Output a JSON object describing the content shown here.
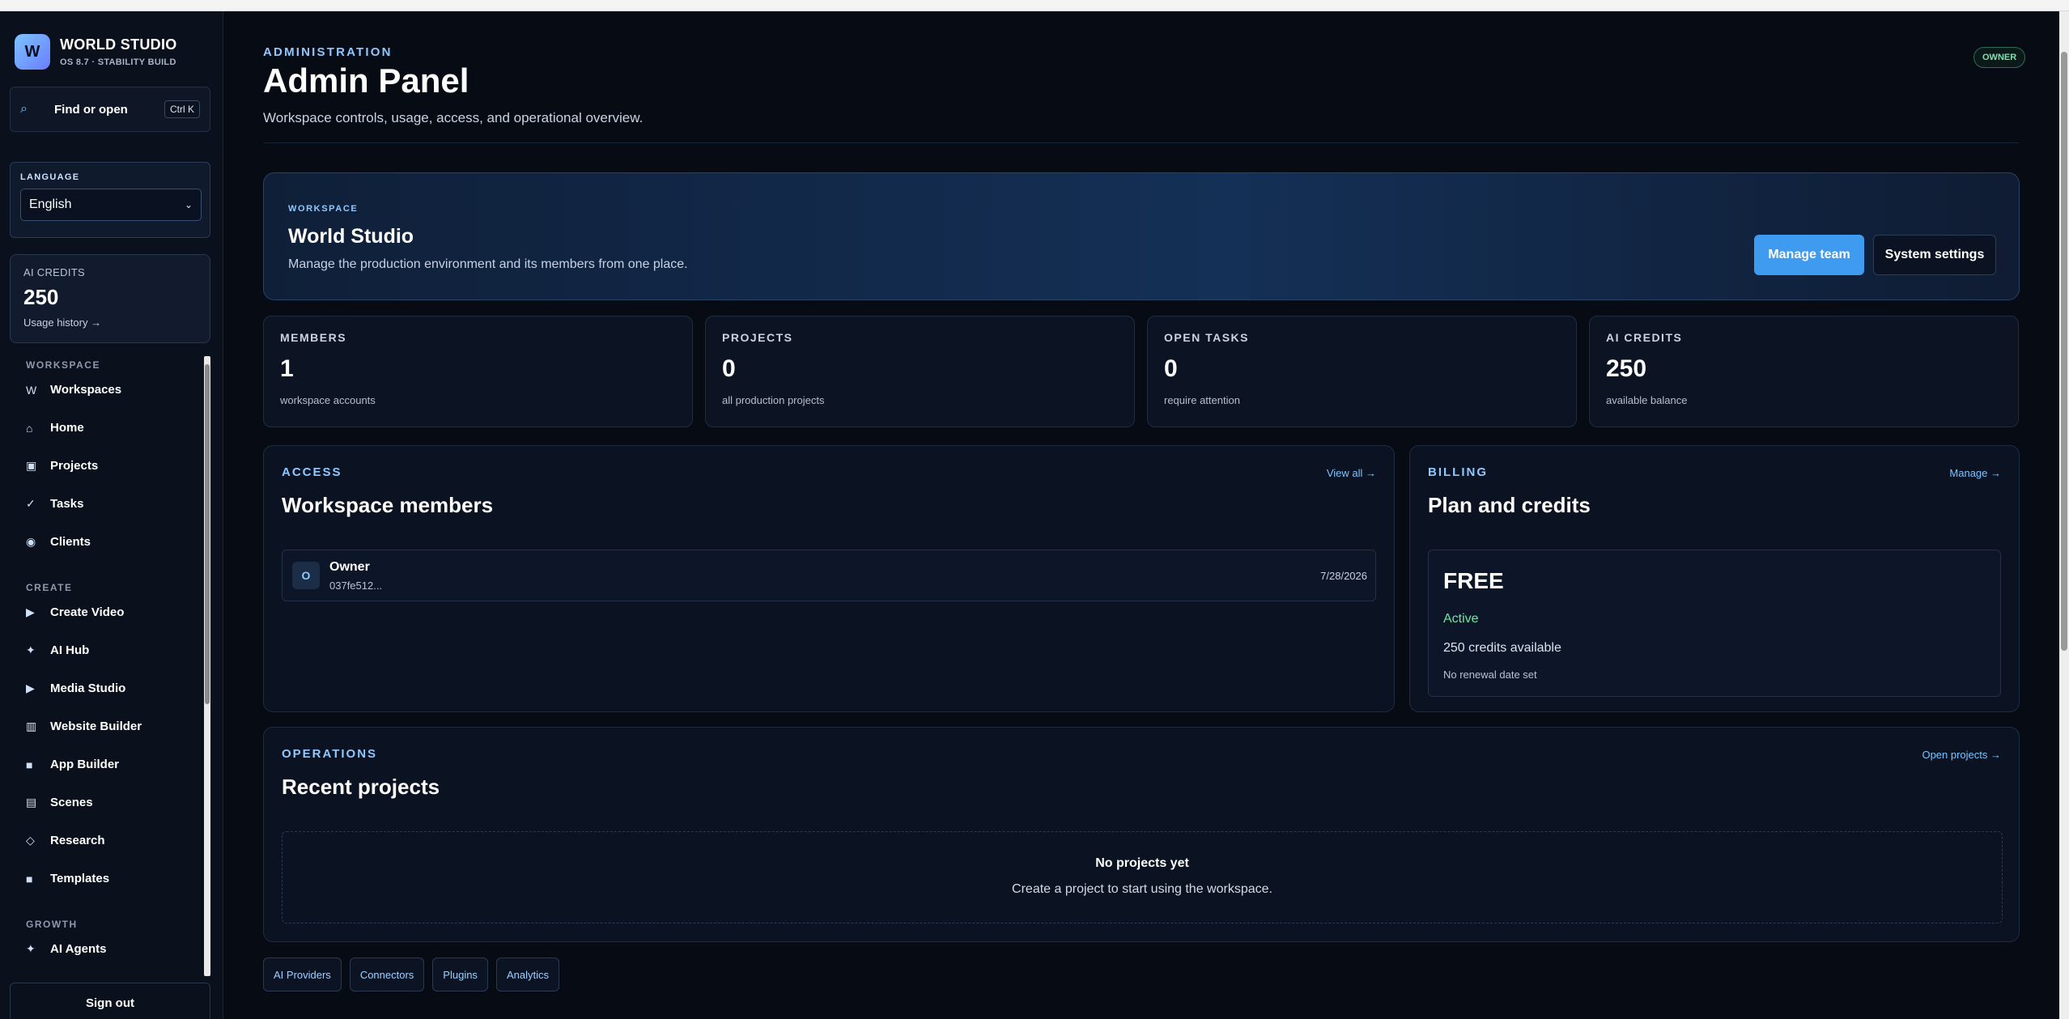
{
  "brand": {
    "logo_letter": "W",
    "name": "WORLD STUDIO",
    "subtitle": "OS 8.7 · STABILITY BUILD"
  },
  "search": {
    "label": "Find or open",
    "shortcut": "Ctrl K",
    "icon": "search-icon"
  },
  "language": {
    "label": "LANGUAGE",
    "selected": "English"
  },
  "sidebar_credits": {
    "label": "AI CREDITS",
    "value": "250",
    "link": "Usage history →"
  },
  "nav": {
    "sections": [
      {
        "title": "WORKSPACE",
        "items": [
          {
            "label": "Workspaces",
            "icon": "W"
          },
          {
            "label": "Home",
            "icon": "⌂"
          },
          {
            "label": "Projects",
            "icon": "▣"
          },
          {
            "label": "Tasks",
            "icon": "✓"
          },
          {
            "label": "Clients",
            "icon": "◉"
          }
        ]
      },
      {
        "title": "CREATE",
        "items": [
          {
            "label": "Create Video",
            "icon": "▶"
          },
          {
            "label": "AI Hub",
            "icon": "✦"
          },
          {
            "label": "Media Studio",
            "icon": "▶"
          },
          {
            "label": "Website Builder",
            "icon": "▥"
          },
          {
            "label": "App Builder",
            "icon": "■"
          },
          {
            "label": "Scenes",
            "icon": "▤"
          },
          {
            "label": "Research",
            "icon": "◇"
          },
          {
            "label": "Templates",
            "icon": "■"
          }
        ]
      },
      {
        "title": "GROWTH",
        "items": [
          {
            "label": "AI Agents",
            "icon": "✦"
          }
        ]
      }
    ],
    "sign_out": "Sign out"
  },
  "header": {
    "eyebrow": "ADMINISTRATION",
    "title": "Admin Panel",
    "subtitle": "Workspace controls, usage, access, and operational overview.",
    "role_badge": "OWNER"
  },
  "hero": {
    "tag": "WORKSPACE",
    "title": "World Studio",
    "description": "Manage the production environment and its members from one place.",
    "primary_button": "Manage team",
    "secondary_button": "System settings"
  },
  "stats": [
    {
      "label": "MEMBERS",
      "value": "1",
      "sub": "workspace accounts"
    },
    {
      "label": "PROJECTS",
      "value": "0",
      "sub": "all production projects"
    },
    {
      "label": "OPEN TASKS",
      "value": "0",
      "sub": "require attention"
    },
    {
      "label": "AI CREDITS",
      "value": "250",
      "sub": "available balance"
    }
  ],
  "access": {
    "tag": "ACCESS",
    "title": "Workspace members",
    "link": "View all →",
    "members": [
      {
        "initial": "O",
        "name": "Owner",
        "id": "037fe512...",
        "date": "7/28/2026"
      }
    ]
  },
  "billing": {
    "tag": "BILLING",
    "title": "Plan and credits",
    "link": "Manage →",
    "plan": "FREE",
    "status": "Active",
    "credits": "250 credits available",
    "renewal": "No renewal date set"
  },
  "operations": {
    "tag": "OPERATIONS",
    "title": "Recent projects",
    "link": "Open projects →",
    "empty_title": "No projects yet",
    "empty_desc": "Create a project to start using the workspace."
  },
  "footer_chips": [
    "AI Providers",
    "Connectors",
    "Plugins",
    "Analytics"
  ],
  "colors": {
    "accent": "#3f9bf0",
    "link": "#7cc4ff",
    "success": "#6ee7a0",
    "background": "#070b14"
  }
}
